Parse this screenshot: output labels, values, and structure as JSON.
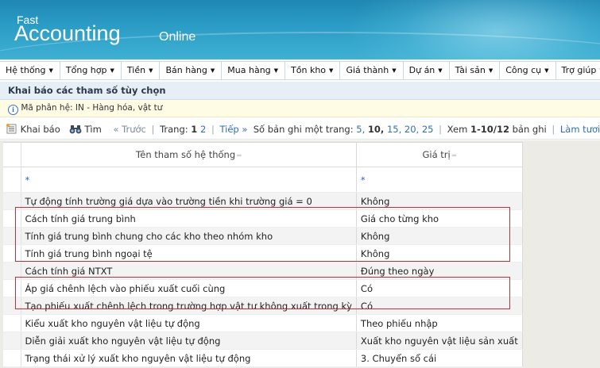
{
  "header": {
    "logo_top": "Fast",
    "logo_main": "Accounting",
    "logo_sub": "Online"
  },
  "menu": [
    {
      "label": "Hệ thống"
    },
    {
      "label": "Tổng hợp"
    },
    {
      "label": "Tiền"
    },
    {
      "label": "Bán hàng"
    },
    {
      "label": "Mua hàng"
    },
    {
      "label": "Tồn kho"
    },
    {
      "label": "Giá thành"
    },
    {
      "label": "Dự án"
    },
    {
      "label": "Tài sản"
    },
    {
      "label": "Công cụ"
    },
    {
      "label": "Trợ giúp"
    }
  ],
  "page": {
    "title": "Khai báo các tham số tùy chọn",
    "info_icon": "info-icon",
    "info_text": "Mã phân hệ: IN - Hàng hóa, vật tư"
  },
  "toolbar": {
    "declare_label": "Khai báo",
    "find_label": "Tìm",
    "prev_label": "« Trước",
    "page_label": "Trang:",
    "page_current": "1",
    "page_next_num": "2",
    "next_label": "Tiếp »",
    "page_size_label": "Số bản ghi một trang:",
    "page_sizes": [
      "5,",
      "10,",
      "15,",
      "20,",
      "25"
    ],
    "view_label": "Xem",
    "view_range": "1-10/12",
    "records_label": "bản ghi",
    "refresh_label": "Làm tươi",
    "colors": {
      "link": "#2f6fb5",
      "highlight_box": "#c0303a"
    }
  },
  "grid": {
    "columns": [
      "Tên tham số hệ thống",
      "Giá trị"
    ],
    "filter": [
      "*",
      "*"
    ],
    "rows": [
      {
        "name": "Tự động tính trường giá dựa vào trường tiền khi trường giá = 0",
        "value": "Không"
      },
      {
        "name": "Cách tính giá trung bình",
        "value": "Giá cho từng kho"
      },
      {
        "name": "Tính giá trung bình chung cho các kho theo nhóm kho",
        "value": "Không"
      },
      {
        "name": "Tính giá trung bình ngoại tệ",
        "value": "Không"
      },
      {
        "name": "Cách tính giá NTXT",
        "value": "Đúng theo ngày"
      },
      {
        "name": "Áp giá chênh lệch vào phiếu xuất cuối cùng",
        "value": "Có"
      },
      {
        "name": "Tạo phiếu xuất chênh lệch trong trường hợp vật tư không xuất trong kỳ",
        "value": "Có"
      },
      {
        "name": "Kiểu xuất kho nguyên vật liệu tự động",
        "value": "Theo phiếu nhập"
      },
      {
        "name": "Diễn giải xuất kho nguyên vật liệu tự động",
        "value": "Xuất kho nguyên vật liệu sản xuất"
      },
      {
        "name": "Trạng thái xử lý xuất kho nguyên vật liệu tự động",
        "value": "3. Chuyển sổ cái"
      }
    ]
  }
}
